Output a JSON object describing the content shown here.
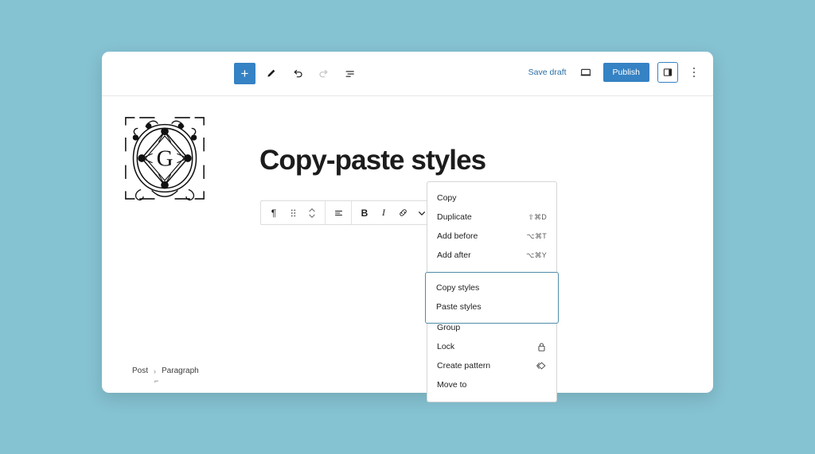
{
  "theme": {
    "background": "#85c2d2",
    "accent_blue": "#3582c4",
    "link_blue": "#2a6ea6",
    "highlight_border": "#4e8ca8",
    "card_background": "#ffffff",
    "text": "#1e1e1e"
  },
  "top_bar": {
    "add_block_label": "+",
    "add_block_name": "add-block",
    "tools_label": "Tools",
    "undo_label": "Undo",
    "redo_label": "Redo",
    "list_view_label": "Document overview",
    "save_draft_label": "Save draft",
    "preview_label": "Preview",
    "publish_label": "Publish",
    "sidebar_toggle_label": "Settings",
    "more_options_label": "Options"
  },
  "canvas": {
    "post_title": "Copy-paste styles",
    "monogram_letter": "G",
    "monogram_alt": "Ornamental G monogram image block"
  },
  "block_toolbar": {
    "paragraph_label": "¶",
    "drag_label": "Drag",
    "move_label": "Move up or down",
    "align_label": "Align text",
    "bold_label": "B",
    "italic_label": "I",
    "link_label": "Link",
    "more_rich_text_label": "More",
    "options_label": "Options"
  },
  "dropdown": {
    "groups": [
      {
        "name": "basic",
        "highlighted": false,
        "items": [
          {
            "label": "Copy",
            "shortcut": "",
            "icon": ""
          },
          {
            "label": "Duplicate",
            "shortcut": "⇧⌘D",
            "icon": ""
          },
          {
            "label": "Add before",
            "shortcut": "⌥⌘T",
            "icon": ""
          },
          {
            "label": "Add after",
            "shortcut": "⌥⌘Y",
            "icon": ""
          }
        ]
      },
      {
        "name": "styles",
        "highlighted": true,
        "items": [
          {
            "label": "Copy styles",
            "shortcut": "",
            "icon": ""
          },
          {
            "label": "Paste styles",
            "shortcut": "",
            "icon": ""
          }
        ]
      },
      {
        "name": "transform",
        "highlighted": false,
        "items": [
          {
            "label": "Group",
            "shortcut": "",
            "icon": ""
          },
          {
            "label": "Lock",
            "shortcut": "",
            "icon": "lock-icon"
          },
          {
            "label": "Create pattern",
            "shortcut": "",
            "icon": "pattern-icon"
          },
          {
            "label": "Move to",
            "shortcut": "",
            "icon": ""
          }
        ]
      }
    ]
  },
  "breadcrumb": {
    "post_label": "Post",
    "separator": "›",
    "block_label": "Paragraph"
  },
  "cursor": {
    "mark": "⌐"
  }
}
